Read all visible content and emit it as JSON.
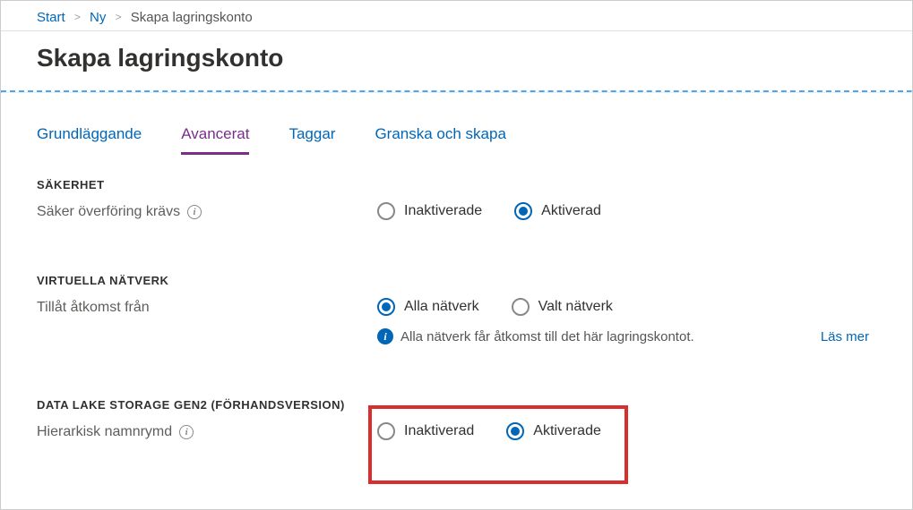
{
  "breadcrumb": {
    "items": [
      "Start",
      "Ny",
      "Skapa lagringskonto"
    ]
  },
  "page_title": "Skapa lagringskonto",
  "tabs": [
    {
      "label": "Grundläggande",
      "active": false
    },
    {
      "label": "Avancerat",
      "active": true
    },
    {
      "label": "Taggar",
      "active": false
    },
    {
      "label": "Granska och skapa",
      "active": false
    }
  ],
  "sections": {
    "security": {
      "title": "SÄKERHET",
      "secure_transfer": {
        "label": "Säker överföring krävs",
        "options": {
          "disabled": "Inaktiverade",
          "enabled": "Aktiverad"
        },
        "selected": "enabled"
      }
    },
    "vnet": {
      "title": "VIRTUELLA NÄTVERK",
      "allow_access": {
        "label": "Tillåt åtkomst från",
        "options": {
          "all": "Alla nätverk",
          "selected": "Valt nätverk"
        },
        "selected": "all",
        "info": "Alla nätverk får åtkomst till det här lagringskontot.",
        "learn_more": "Läs mer"
      }
    },
    "adls": {
      "title": "DATA LAKE STORAGE GEN2 (FÖRHANDSVERSION)",
      "hns": {
        "label": "Hierarkisk namnrymd",
        "options": {
          "disabled": "Inaktiverad",
          "enabled": "Aktiverade"
        },
        "selected": "enabled"
      }
    }
  }
}
